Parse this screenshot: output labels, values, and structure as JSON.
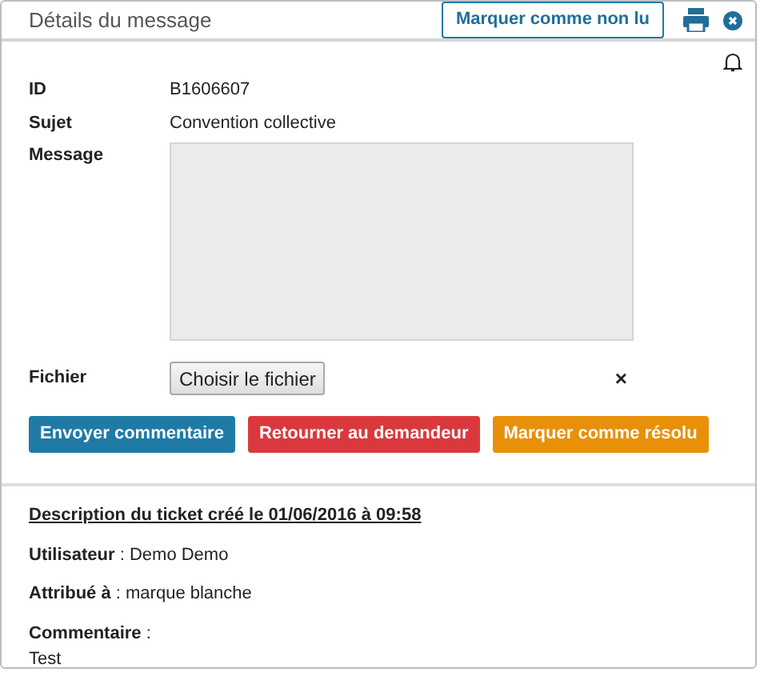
{
  "dialog": {
    "title": "Détails du message",
    "mark_unread_button": "Marquer comme non lu"
  },
  "fields": [
    {
      "kind": "text",
      "label": "ID",
      "value": "B1606607"
    },
    {
      "kind": "text",
      "label": "Sujet",
      "value": "Convention collective"
    },
    {
      "kind": "textarea",
      "label": "Message"
    },
    {
      "kind": "file",
      "label": "Fichier",
      "button": "Choisir le fichier",
      "clear": "×"
    }
  ],
  "actions": [
    {
      "label": "Envoyer commentaire",
      "color": "#1f7ba6"
    },
    {
      "label": "Retourner au demandeur",
      "color": "#d9393c"
    },
    {
      "label": "Marquer comme résolu",
      "color": "#e8900a"
    }
  ],
  "ticket": {
    "heading": "Description du ticket créé le 01/06/2016 à 09:58",
    "lines": [
      "**Utilisateur** : Demo Demo",
      "**Attribué à** : marque blanche"
    ],
    "comment_label": "**Commentaire** :",
    "comment": "Test"
  }
}
